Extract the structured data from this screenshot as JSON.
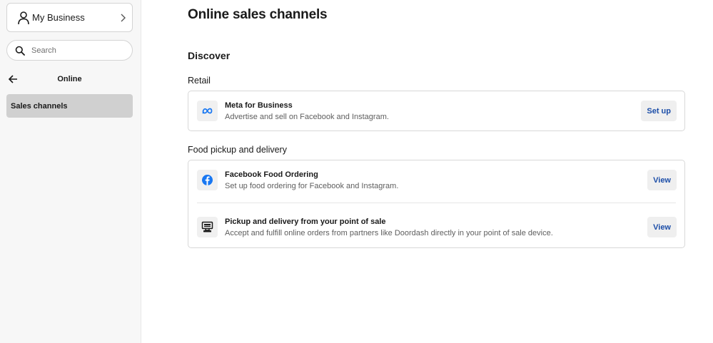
{
  "sidebar": {
    "business_name": "My Business",
    "search": {
      "placeholder": "Search",
      "value": ""
    },
    "section_title": "Online",
    "items": [
      {
        "label": "Sales channels",
        "active": true
      }
    ]
  },
  "main": {
    "title": "Online sales channels",
    "discover_heading": "Discover",
    "sections": [
      {
        "heading": "Retail",
        "channels": [
          {
            "icon": "meta-icon",
            "name": "Meta for Business",
            "description": "Advertise and sell on Facebook and Instagram.",
            "action": "Set up"
          }
        ]
      },
      {
        "heading": "Food pickup and delivery",
        "channels": [
          {
            "icon": "facebook-icon",
            "name": "Facebook Food Ordering",
            "description": "Set up food ordering for Facebook and Instagram.",
            "action": "View"
          },
          {
            "icon": "point-of-sale-icon",
            "name": "Pickup and delivery from your point of sale",
            "description": "Accept and fulfill online orders from partners like Doordash directly in your point of sale device.",
            "action": "View"
          }
        ]
      }
    ]
  },
  "colors": {
    "accent": "#1c4ea8",
    "facebook_blue": "#1877f2",
    "active_nav_bg": "#d0d0d0"
  }
}
